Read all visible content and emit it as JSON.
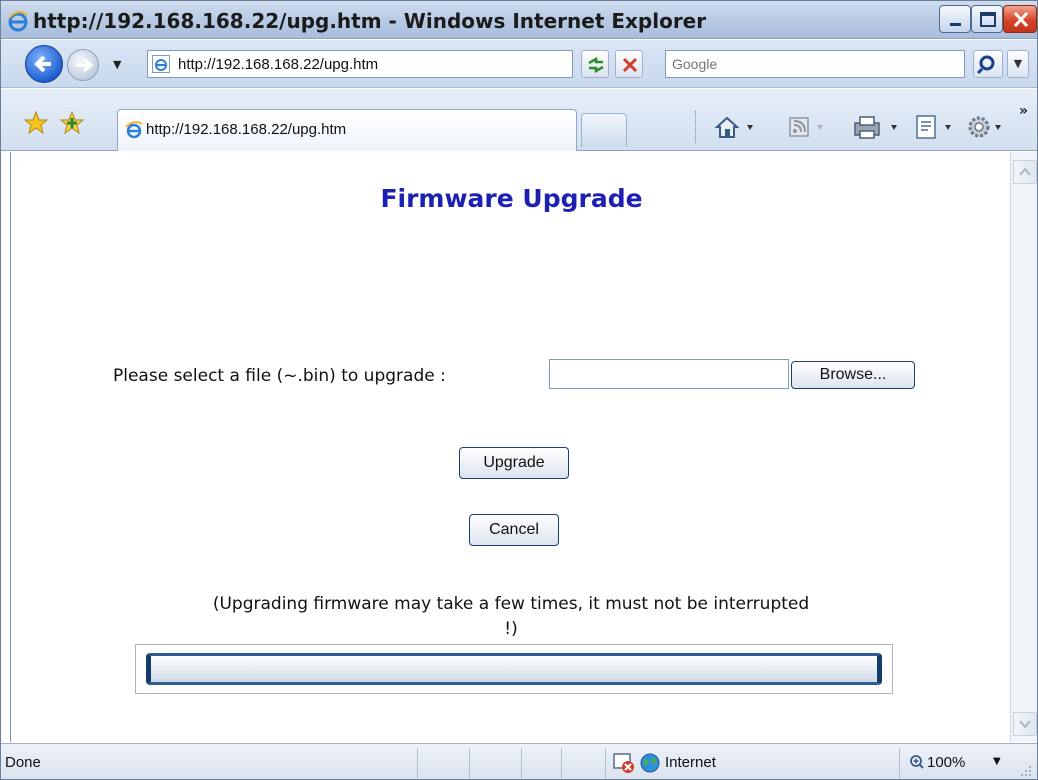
{
  "window": {
    "title": "http://192.168.168.22/upg.htm - Windows Internet Explorer"
  },
  "address_bar": {
    "url": "http://192.168.168.22/upg.htm"
  },
  "search": {
    "placeholder": "Google"
  },
  "tabs": [
    {
      "label": "http://192.168.168.22/upg.htm"
    }
  ],
  "nav": {
    "dropdown_glyph": "▼",
    "search_dropdown_glyph": "▼",
    "more_glyph": "»"
  },
  "page": {
    "title": "Firmware Upgrade",
    "file_label": "Please select a file (~.bin) to upgrade :",
    "file_value": "",
    "browse_label": "Browse...",
    "upgrade_label": "Upgrade",
    "cancel_label": "Cancel",
    "note": "(Upgrading firmware may take a few times, it must not be interrupted !)",
    "progress": 0
  },
  "status": {
    "text": "Done",
    "zone": "Internet",
    "zoom": "100%",
    "zoom_dropdown_glyph": "▼"
  },
  "colors": {
    "title_blue": "#1d20b2",
    "progress_border": "#123d6a",
    "close_red": "#d6452a"
  }
}
